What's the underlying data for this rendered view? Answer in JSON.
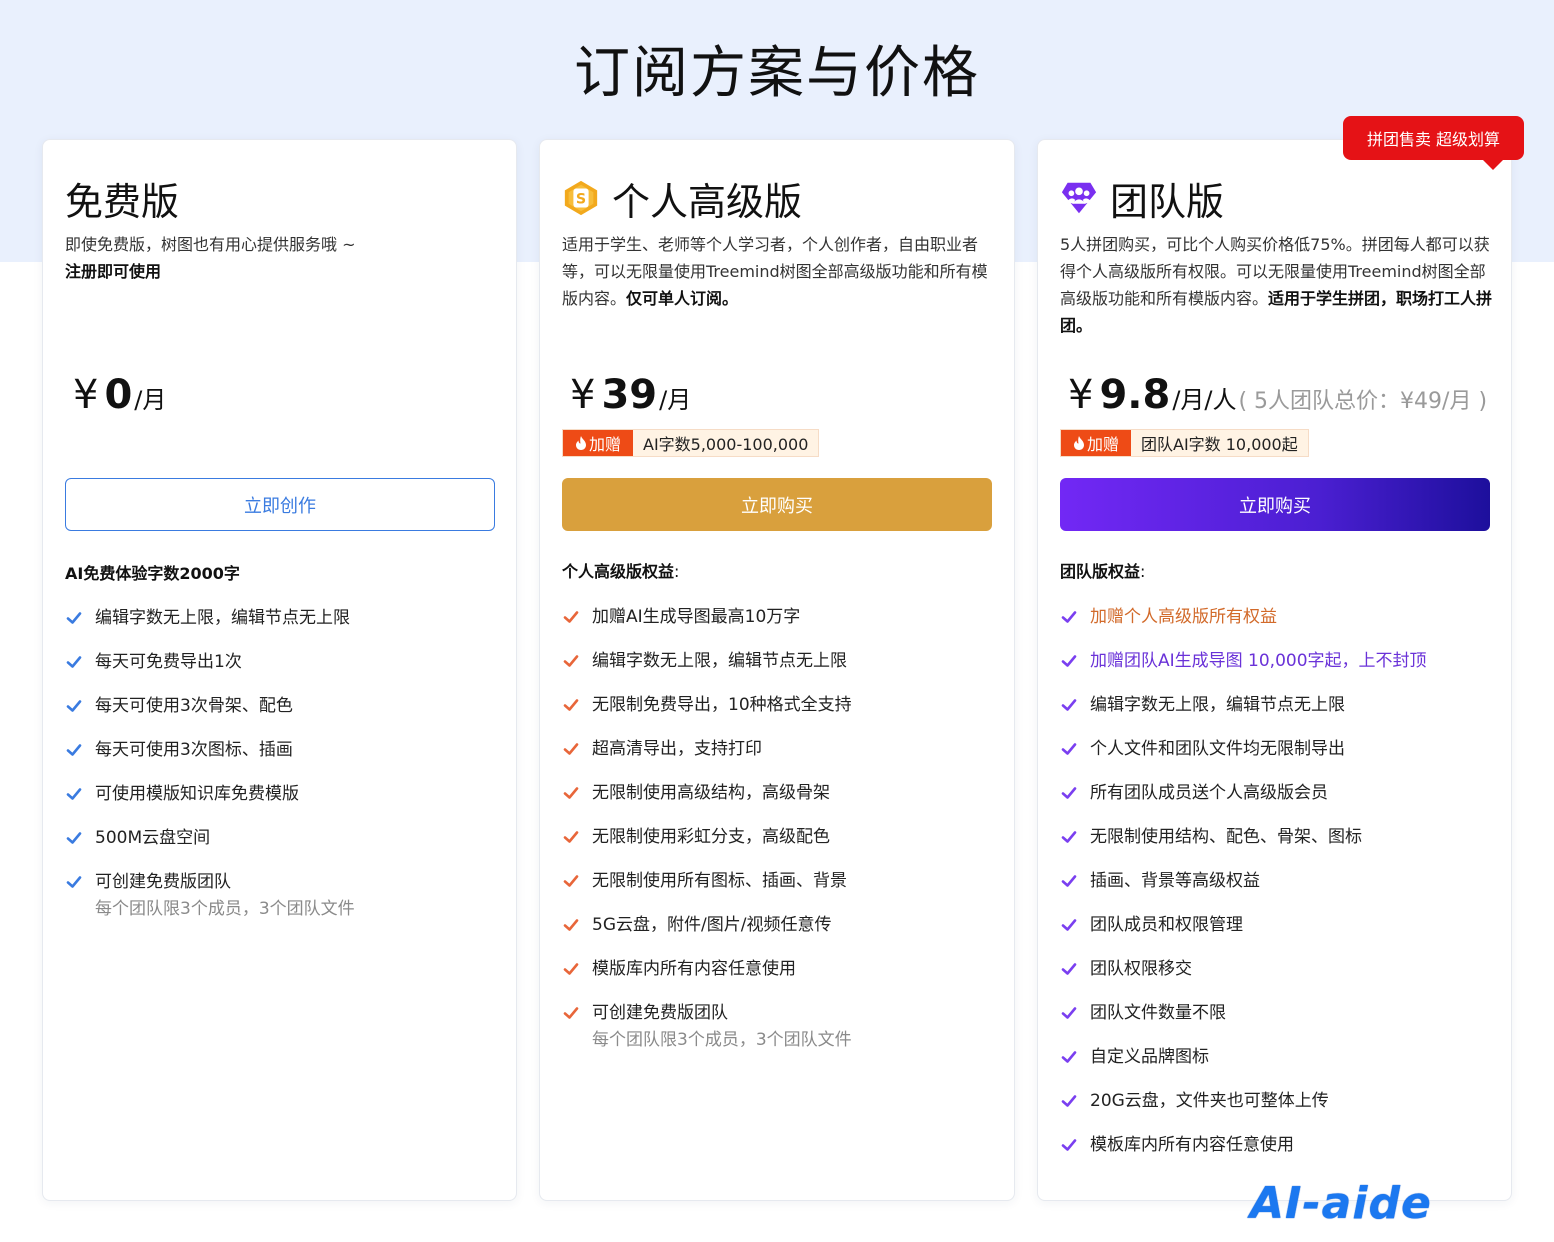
{
  "page": {
    "title": "订阅方案与价格"
  },
  "promo_badge": "拼团售卖 超级划算",
  "watermark": "AI-aide",
  "free": {
    "name": "免费版",
    "desc_line1": "即使免费版，树图也有用心提供服务哦 ~",
    "desc_bold": "注册即可使用",
    "yen": "¥",
    "price": "0",
    "unit": "/月",
    "cta": "立即创作",
    "benefit_title": "AI免费体验字数2000字",
    "benefits": [
      "编辑字数无上限，编辑节点无上限",
      "每天可免费导出1次",
      "每天可使用3次骨架、配色",
      "每天可使用3次图标、插画",
      "可使用模版知识库免费模版",
      "500M云盘空间",
      "可创建免费版团队"
    ],
    "benefit_sub": "每个团队限3个成员，3个团队文件"
  },
  "pro": {
    "name": "个人高级版",
    "icon": "gold-s-coin-icon",
    "desc_text": "适用于学生、老师等个人学习者，个人创作者，自由职业者等，可以无限量使用Treemind树图全部高级版功能和所有模版内容。",
    "desc_bold": "仅可单人订阅。",
    "yen": "¥",
    "price": "39",
    "unit": "/月",
    "bonus_tag": "加赠",
    "bonus_text": "AI字数5,000-100,000",
    "cta": "立即购买",
    "benefit_title": "个人高级版权益",
    "colon": ":",
    "benefits": [
      "加赠AI生成导图最高10万字",
      "编辑字数无上限，编辑节点无上限",
      "无限制免费导出，10种格式全支持",
      "超高清导出，支持打印",
      "无限制使用高级结构，高级骨架",
      "无限制使用彩虹分支，高级配色",
      "无限制使用所有图标、插画、背景",
      "5G云盘，附件/图片/视频任意传",
      "模版库内所有内容任意使用",
      "可创建免费版团队"
    ],
    "benefit_sub": "每个团队限3个成员，3个团队文件"
  },
  "team": {
    "name": "团队版",
    "icon": "purple-team-gem-icon",
    "desc_text": "5人拼团购买，可比个人购买价格低75%。拼团每人都可以获得个人高级版所有权限。可以无限量使用Treemind树图全部高级版功能和所有模版内容。",
    "desc_bold": "适用于学生拼团，职场打工人拼团。",
    "yen": "¥",
    "price": "9.8",
    "unit": "/月/人",
    "note": "( 5人团队总价：¥49/月 )",
    "bonus_tag": "加赠",
    "bonus_text": "团队AI字数 10,000起",
    "cta": "立即购买",
    "benefit_title": "团队版权益",
    "colon": ":",
    "benefits": [
      "加赠个人高级版所有权益",
      "加赠团队AI生成导图 10,000字起，上不封顶",
      "编辑字数无上限，编辑节点无上限",
      "个人文件和团队文件均无限制导出",
      "所有团队成员送个人高级版会员",
      "无限制使用结构、配色、骨架、图标",
      "插画、背景等高级权益",
      "团队成员和权限管理",
      "团队权限移交",
      "团队文件数量不限",
      "自定义品牌图标",
      "20G云盘，文件夹也可整体上传",
      "模板库内所有内容任意使用"
    ]
  },
  "colors": {
    "check_blue": "#3a7be0",
    "check_orange": "#e8663a",
    "check_purple": "#7a3ff0",
    "pro_button": "#d9a03d",
    "team_button_start": "#7228f5",
    "team_button_end": "#1d0f9c",
    "highlight_orange": "#d26a2a",
    "highlight_purple": "#6a32d8"
  }
}
